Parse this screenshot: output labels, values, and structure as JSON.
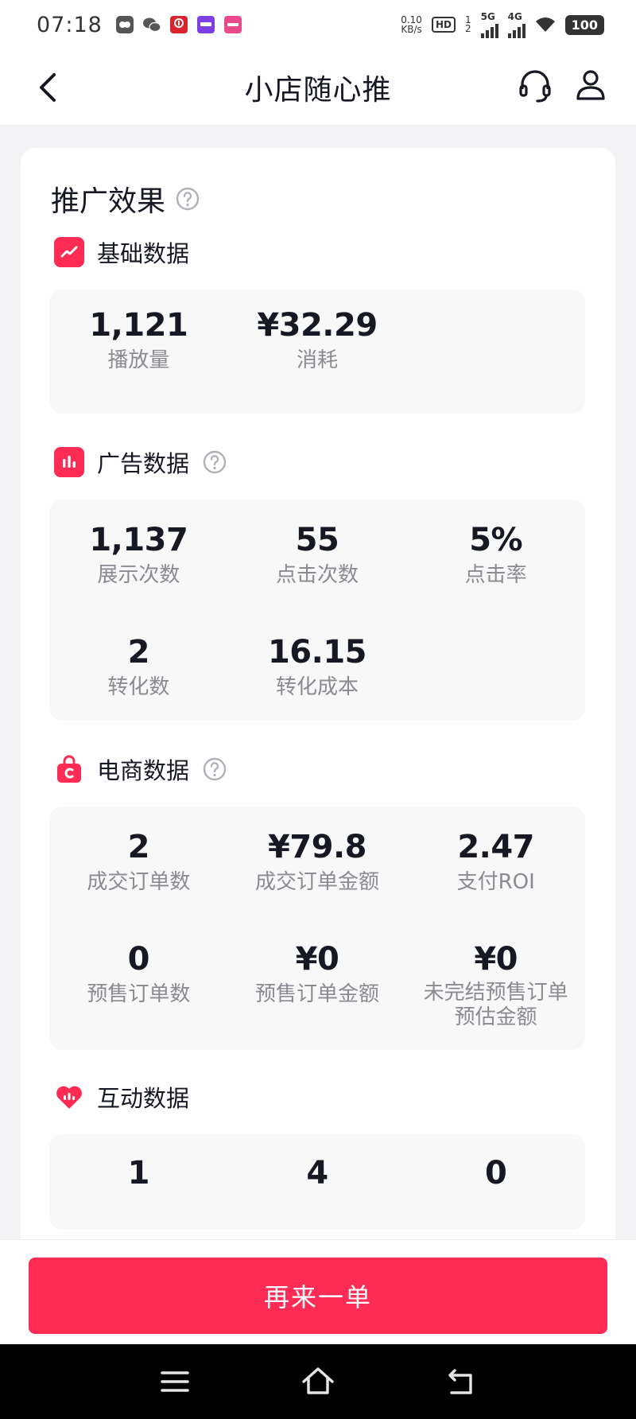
{
  "status": {
    "time": "07:18",
    "net_speed_value": "0.10",
    "net_speed_unit": "KB/s",
    "hd": "HD",
    "sim1": "1",
    "sim2": "2",
    "gen1": "5G",
    "gen2": "4G",
    "battery": "100"
  },
  "nav": {
    "title": "小店随心推"
  },
  "card": {
    "title": "推广效果"
  },
  "sections": {
    "basic": {
      "title": "基础数据",
      "stats": [
        {
          "value": "1,121",
          "label": "播放量"
        },
        {
          "value": "¥32.29",
          "label": "消耗"
        }
      ]
    },
    "ad": {
      "title": "广告数据",
      "stats": [
        {
          "value": "1,137",
          "label": "展示次数"
        },
        {
          "value": "55",
          "label": "点击次数"
        },
        {
          "value": "5%",
          "label": "点击率"
        },
        {
          "value": "2",
          "label": "转化数"
        },
        {
          "value": "16.15",
          "label": "转化成本"
        }
      ]
    },
    "ecom": {
      "title": "电商数据",
      "stats": [
        {
          "value": "2",
          "label": "成交订单数"
        },
        {
          "value": "¥79.8",
          "label": "成交订单金额"
        },
        {
          "value": "2.47",
          "label": "支付ROI"
        },
        {
          "value": "0",
          "label": "预售订单数"
        },
        {
          "value": "¥0",
          "label": "预售订单金额"
        },
        {
          "value": "¥0",
          "label": "未完结预售订单",
          "label2": "预估金额"
        }
      ]
    },
    "interact": {
      "title": "互动数据",
      "stats": [
        {
          "value": "1"
        },
        {
          "value": "4"
        },
        {
          "value": "0"
        }
      ]
    }
  },
  "bottom": {
    "button_label": "再来一单"
  },
  "colors": {
    "accent": "#fe2c55",
    "text": "#161823",
    "muted": "#8a8b91"
  }
}
